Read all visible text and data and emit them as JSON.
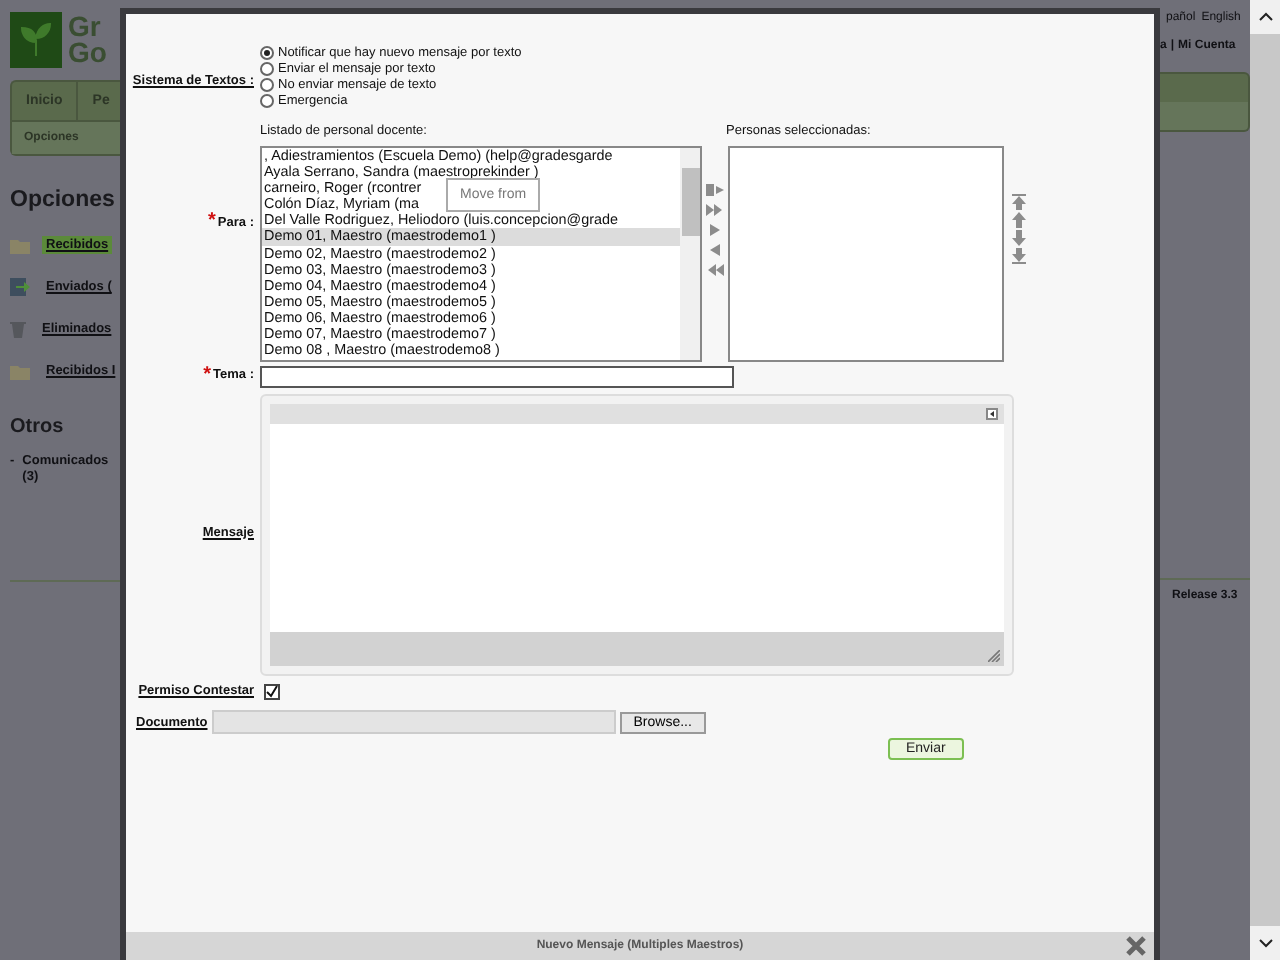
{
  "header": {
    "logo_lines": [
      "Gr",
      "Go"
    ],
    "languages": [
      "pañol",
      "English"
    ],
    "account_links": [
      "a",
      "Mi Cuenta"
    ],
    "account_separator": "|"
  },
  "nav": {
    "tabs": [
      {
        "label": "Inicio",
        "selected": false
      },
      {
        "label": "Pe",
        "selected": false
      }
    ],
    "subnav": [
      "Opciones"
    ]
  },
  "sidebar": {
    "heading": "Opciones",
    "folders": [
      {
        "kind": "inbox",
        "label": "Recibidos",
        "selected": true
      },
      {
        "kind": "sent",
        "label": "Enviados (",
        "selected": false
      },
      {
        "kind": "trash",
        "label": "Eliminados",
        "selected": false
      },
      {
        "kind": "inbox",
        "label": "Recibidos I",
        "selected": false
      }
    ],
    "others_heading": "Otros",
    "others": [
      {
        "bullet": "-",
        "label": "Comunicados (3)"
      }
    ]
  },
  "release": "Release 3.3",
  "dialog": {
    "title": "Nuevo Mensaje (Multiples Maestros)",
    "sms": {
      "label": "Sistema de Textos :",
      "options": [
        {
          "label": "Notificar que hay nuevo mensaje por texto",
          "selected": true
        },
        {
          "label": "Enviar el mensaje por texto",
          "selected": false
        },
        {
          "label": "No enviar mensaje de texto",
          "selected": false
        },
        {
          "label": "Emergencia",
          "selected": false
        }
      ]
    },
    "recipients": {
      "label": "Para :",
      "required_mark": "*",
      "list_label": "Listado de personal docente:",
      "selected_label": "Personas seleccionadas:",
      "tooltip": "Move from",
      "items": [
        {
          "label": ", Adiestramientos (Escuela Demo) (help@gradesgarde",
          "selected": false
        },
        {
          "label": "Ayala Serrano, Sandra (maestroprekinder )",
          "selected": false
        },
        {
          "label": "carneiro, Roger (rcontrer",
          "selected": false
        },
        {
          "label": "Colón Díaz, Myriam (ma",
          "selected": false
        },
        {
          "label": "Del Valle Rodriguez, Heliodoro (luis.concepcion@grade",
          "selected": false
        },
        {
          "label": "Demo 01, Maestro (maestrodemo1 )",
          "selected": true
        },
        {
          "label": "Demo 02, Maestro (maestrodemo2 )",
          "selected": false
        },
        {
          "label": "Demo 03, Maestro (maestrodemo3 )",
          "selected": false
        },
        {
          "label": "Demo 04, Maestro (maestrodemo4 )",
          "selected": false
        },
        {
          "label": "Demo 05, Maestro (maestrodemo5 )",
          "selected": false
        },
        {
          "label": "Demo 06, Maestro (maestrodemo6 )",
          "selected": false
        },
        {
          "label": "Demo 07, Maestro (maestrodemo7 )",
          "selected": false
        },
        {
          "label": "Demo 08 , Maestro (maestrodemo8 )",
          "selected": false
        }
      ]
    },
    "subject": {
      "label": "Tema :",
      "required_mark": "*"
    },
    "message": {
      "label": "Mensaje"
    },
    "reply_permission": {
      "label": "Permiso Contestar",
      "checked": true
    },
    "document": {
      "label": "Documento",
      "button": "Browse..."
    },
    "send": "Enviar"
  }
}
